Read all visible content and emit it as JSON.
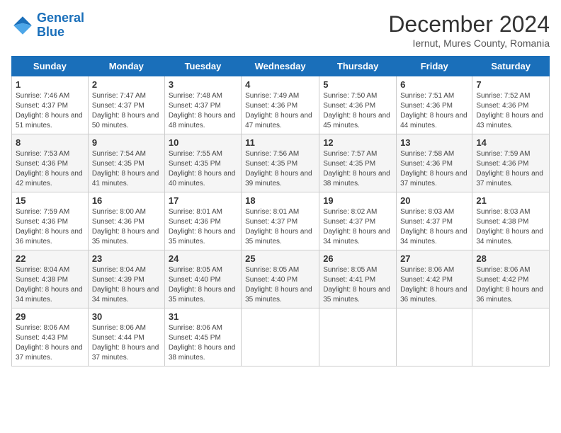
{
  "logo": {
    "line1": "General",
    "line2": "Blue"
  },
  "title": "December 2024",
  "location": "Iernut, Mures County, Romania",
  "headers": [
    "Sunday",
    "Monday",
    "Tuesday",
    "Wednesday",
    "Thursday",
    "Friday",
    "Saturday"
  ],
  "weeks": [
    [
      {
        "day": "1",
        "sunrise": "Sunrise: 7:46 AM",
        "sunset": "Sunset: 4:37 PM",
        "daylight": "Daylight: 8 hours and 51 minutes."
      },
      {
        "day": "2",
        "sunrise": "Sunrise: 7:47 AM",
        "sunset": "Sunset: 4:37 PM",
        "daylight": "Daylight: 8 hours and 50 minutes."
      },
      {
        "day": "3",
        "sunrise": "Sunrise: 7:48 AM",
        "sunset": "Sunset: 4:37 PM",
        "daylight": "Daylight: 8 hours and 48 minutes."
      },
      {
        "day": "4",
        "sunrise": "Sunrise: 7:49 AM",
        "sunset": "Sunset: 4:36 PM",
        "daylight": "Daylight: 8 hours and 47 minutes."
      },
      {
        "day": "5",
        "sunrise": "Sunrise: 7:50 AM",
        "sunset": "Sunset: 4:36 PM",
        "daylight": "Daylight: 8 hours and 45 minutes."
      },
      {
        "day": "6",
        "sunrise": "Sunrise: 7:51 AM",
        "sunset": "Sunset: 4:36 PM",
        "daylight": "Daylight: 8 hours and 44 minutes."
      },
      {
        "day": "7",
        "sunrise": "Sunrise: 7:52 AM",
        "sunset": "Sunset: 4:36 PM",
        "daylight": "Daylight: 8 hours and 43 minutes."
      }
    ],
    [
      {
        "day": "8",
        "sunrise": "Sunrise: 7:53 AM",
        "sunset": "Sunset: 4:36 PM",
        "daylight": "Daylight: 8 hours and 42 minutes."
      },
      {
        "day": "9",
        "sunrise": "Sunrise: 7:54 AM",
        "sunset": "Sunset: 4:35 PM",
        "daylight": "Daylight: 8 hours and 41 minutes."
      },
      {
        "day": "10",
        "sunrise": "Sunrise: 7:55 AM",
        "sunset": "Sunset: 4:35 PM",
        "daylight": "Daylight: 8 hours and 40 minutes."
      },
      {
        "day": "11",
        "sunrise": "Sunrise: 7:56 AM",
        "sunset": "Sunset: 4:35 PM",
        "daylight": "Daylight: 8 hours and 39 minutes."
      },
      {
        "day": "12",
        "sunrise": "Sunrise: 7:57 AM",
        "sunset": "Sunset: 4:35 PM",
        "daylight": "Daylight: 8 hours and 38 minutes."
      },
      {
        "day": "13",
        "sunrise": "Sunrise: 7:58 AM",
        "sunset": "Sunset: 4:36 PM",
        "daylight": "Daylight: 8 hours and 37 minutes."
      },
      {
        "day": "14",
        "sunrise": "Sunrise: 7:59 AM",
        "sunset": "Sunset: 4:36 PM",
        "daylight": "Daylight: 8 hours and 37 minutes."
      }
    ],
    [
      {
        "day": "15",
        "sunrise": "Sunrise: 7:59 AM",
        "sunset": "Sunset: 4:36 PM",
        "daylight": "Daylight: 8 hours and 36 minutes."
      },
      {
        "day": "16",
        "sunrise": "Sunrise: 8:00 AM",
        "sunset": "Sunset: 4:36 PM",
        "daylight": "Daylight: 8 hours and 35 minutes."
      },
      {
        "day": "17",
        "sunrise": "Sunrise: 8:01 AM",
        "sunset": "Sunset: 4:36 PM",
        "daylight": "Daylight: 8 hours and 35 minutes."
      },
      {
        "day": "18",
        "sunrise": "Sunrise: 8:01 AM",
        "sunset": "Sunset: 4:37 PM",
        "daylight": "Daylight: 8 hours and 35 minutes."
      },
      {
        "day": "19",
        "sunrise": "Sunrise: 8:02 AM",
        "sunset": "Sunset: 4:37 PM",
        "daylight": "Daylight: 8 hours and 34 minutes."
      },
      {
        "day": "20",
        "sunrise": "Sunrise: 8:03 AM",
        "sunset": "Sunset: 4:37 PM",
        "daylight": "Daylight: 8 hours and 34 minutes."
      },
      {
        "day": "21",
        "sunrise": "Sunrise: 8:03 AM",
        "sunset": "Sunset: 4:38 PM",
        "daylight": "Daylight: 8 hours and 34 minutes."
      }
    ],
    [
      {
        "day": "22",
        "sunrise": "Sunrise: 8:04 AM",
        "sunset": "Sunset: 4:38 PM",
        "daylight": "Daylight: 8 hours and 34 minutes."
      },
      {
        "day": "23",
        "sunrise": "Sunrise: 8:04 AM",
        "sunset": "Sunset: 4:39 PM",
        "daylight": "Daylight: 8 hours and 34 minutes."
      },
      {
        "day": "24",
        "sunrise": "Sunrise: 8:05 AM",
        "sunset": "Sunset: 4:40 PM",
        "daylight": "Daylight: 8 hours and 35 minutes."
      },
      {
        "day": "25",
        "sunrise": "Sunrise: 8:05 AM",
        "sunset": "Sunset: 4:40 PM",
        "daylight": "Daylight: 8 hours and 35 minutes."
      },
      {
        "day": "26",
        "sunrise": "Sunrise: 8:05 AM",
        "sunset": "Sunset: 4:41 PM",
        "daylight": "Daylight: 8 hours and 35 minutes."
      },
      {
        "day": "27",
        "sunrise": "Sunrise: 8:06 AM",
        "sunset": "Sunset: 4:42 PM",
        "daylight": "Daylight: 8 hours and 36 minutes."
      },
      {
        "day": "28",
        "sunrise": "Sunrise: 8:06 AM",
        "sunset": "Sunset: 4:42 PM",
        "daylight": "Daylight: 8 hours and 36 minutes."
      }
    ],
    [
      {
        "day": "29",
        "sunrise": "Sunrise: 8:06 AM",
        "sunset": "Sunset: 4:43 PM",
        "daylight": "Daylight: 8 hours and 37 minutes."
      },
      {
        "day": "30",
        "sunrise": "Sunrise: 8:06 AM",
        "sunset": "Sunset: 4:44 PM",
        "daylight": "Daylight: 8 hours and 37 minutes."
      },
      {
        "day": "31",
        "sunrise": "Sunrise: 8:06 AM",
        "sunset": "Sunset: 4:45 PM",
        "daylight": "Daylight: 8 hours and 38 minutes."
      },
      null,
      null,
      null,
      null
    ]
  ]
}
